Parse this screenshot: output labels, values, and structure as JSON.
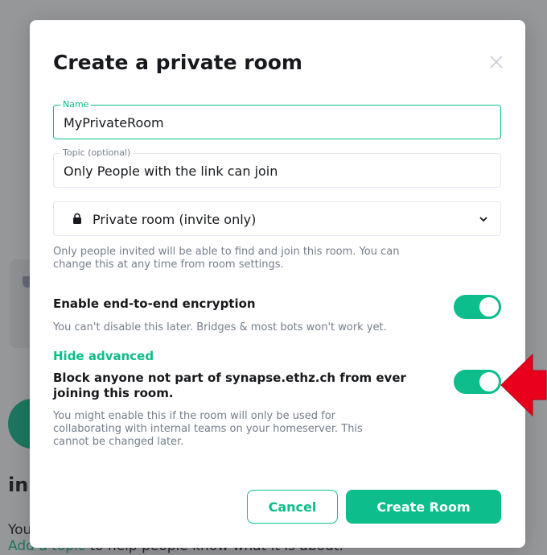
{
  "background": {
    "heading": "in",
    "line1": "You",
    "line2_link": "Add a topic",
    "line2_rest": " to help people know what it is about."
  },
  "dialog": {
    "title": "Create a private room",
    "close_icon": "close-icon",
    "name_field": {
      "legend": "Name",
      "value": "MyPrivateRoom"
    },
    "topic_field": {
      "legend": "Topic (optional)",
      "value": "Only People with the link can join"
    },
    "visibility": {
      "icon": "lock-icon",
      "selected": "Private room (invite only)"
    },
    "visibility_help": "Only people invited will be able to find and join this room. You can change this at any time from room settings.",
    "encryption": {
      "title": "Enable end-to-end encryption",
      "help": "You can't disable this later. Bridges & most bots won't work yet.",
      "enabled": true
    },
    "advanced_toggle": "Hide advanced",
    "block_federation": {
      "title": "Block anyone not part of synapse.ethz.ch from ever joining this room.",
      "help": "You might enable this if the room will only be used for collaborating with internal teams on your homeserver. This cannot be changed later.",
      "enabled": true
    },
    "cancel_label": "Cancel",
    "create_label": "Create Room"
  },
  "colors": {
    "accent": "#0dbd8b",
    "annotation_arrow": "#e8001c",
    "text_primary": "#17191c",
    "text_secondary": "#737d8c"
  }
}
